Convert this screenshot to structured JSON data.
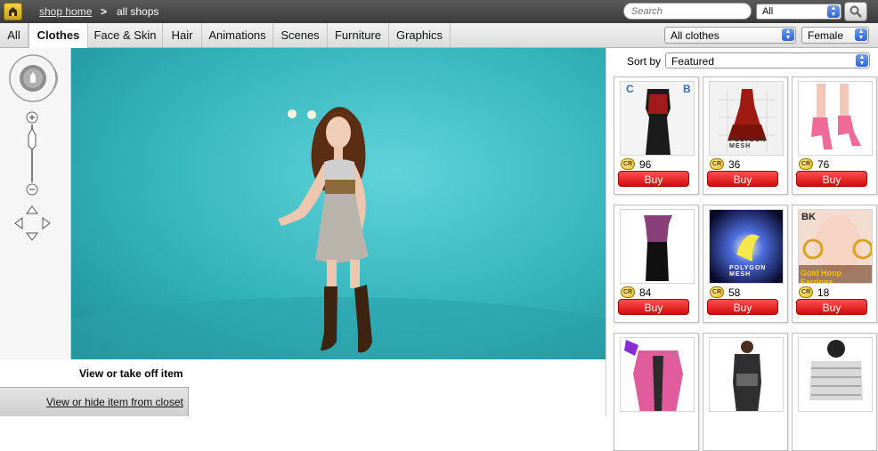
{
  "breadcrumb": {
    "home": "shop home",
    "separator": ">",
    "current": "all shops"
  },
  "search": {
    "placeholder": "Search",
    "scope": "All"
  },
  "tabs": [
    {
      "label": "All"
    },
    {
      "label": "Clothes"
    },
    {
      "label": "Face & Skin"
    },
    {
      "label": "Hair"
    },
    {
      "label": "Animations"
    },
    {
      "label": "Scenes"
    },
    {
      "label": "Furniture"
    },
    {
      "label": "Graphics"
    }
  ],
  "filters": {
    "category": "All clothes",
    "gender": "Female"
  },
  "viewer": {
    "label": "View or take off item",
    "closet_button": "View or hide item from closet"
  },
  "sort": {
    "label": "Sort by",
    "value": "Featured"
  },
  "products": [
    {
      "price": "96",
      "buy": "Buy"
    },
    {
      "price": "36",
      "buy": "Buy"
    },
    {
      "price": "76",
      "buy": "Buy"
    },
    {
      "price": "84",
      "buy": "Buy"
    },
    {
      "price": "58",
      "buy": "Buy"
    },
    {
      "price": "18",
      "buy": "Buy"
    },
    {
      "price": "",
      "buy": ""
    },
    {
      "price": "",
      "buy": ""
    },
    {
      "price": "",
      "buy": ""
    }
  ],
  "thumb_texts": {
    "p2_brand": "POLYGON MESH",
    "p5_brand": "POLYGON MESH",
    "p6_tag": "BK",
    "p6_caption": "Gold Hoop Earrings"
  },
  "colors": {
    "buy": "#e01616",
    "viewer_bg": "#34b3bb",
    "dropdown_accent": "#2c63d4"
  }
}
